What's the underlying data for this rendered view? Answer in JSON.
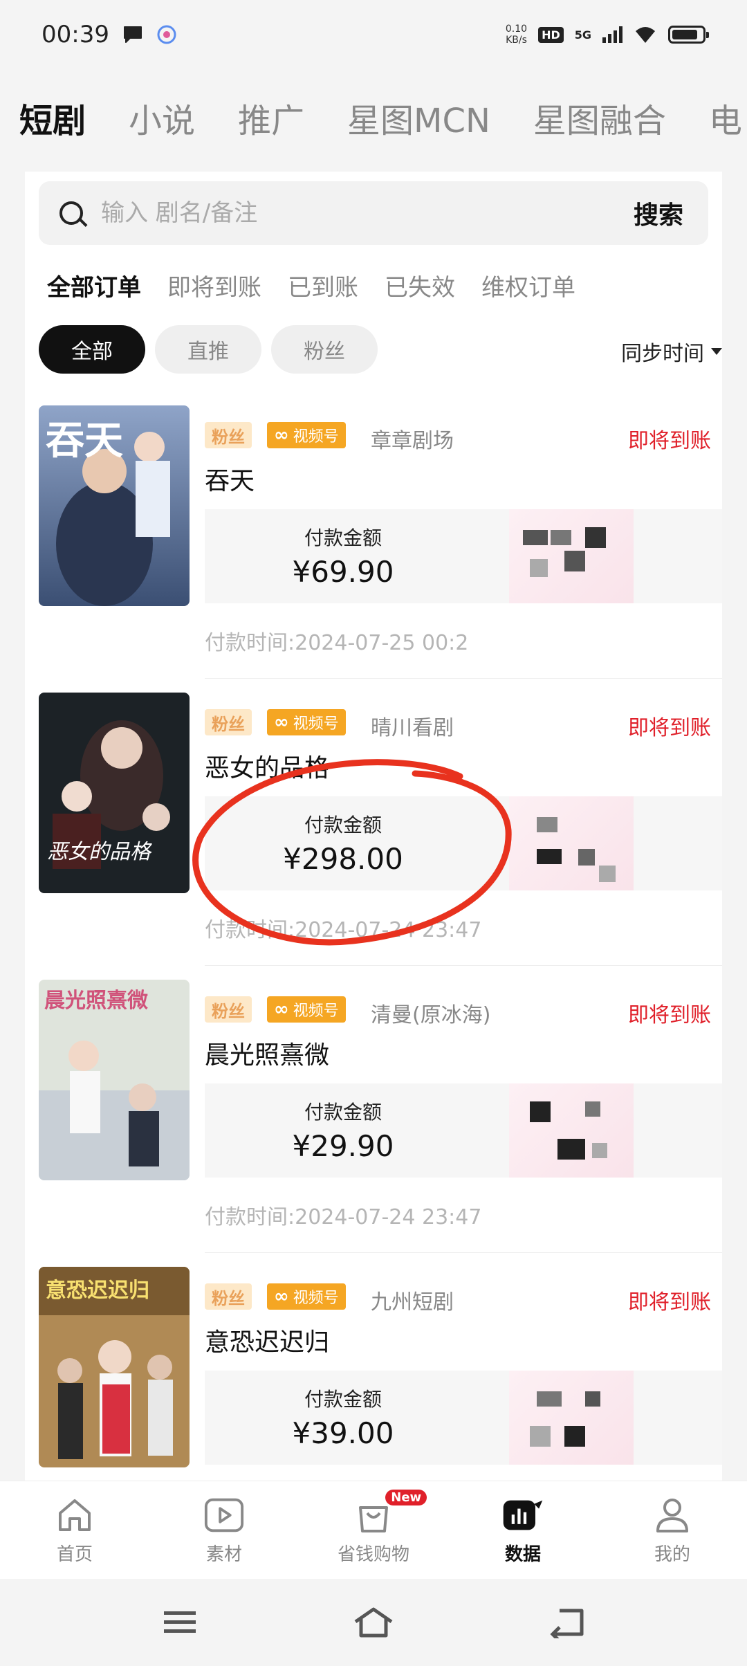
{
  "status_bar": {
    "time": "00:39",
    "net_speed_value": "0.10",
    "net_speed_unit": "KB/s",
    "hd": "HD",
    "network": "5G"
  },
  "top_tabs": [
    "短剧",
    "小说",
    "推广",
    "星图MCN",
    "星图融合",
    "电"
  ],
  "search": {
    "placeholder": "输入 剧名/备注",
    "button": "搜索"
  },
  "status_tabs": [
    "全部订单",
    "即将到账",
    "已到账",
    "已失效",
    "维权订单"
  ],
  "filters": [
    "全部",
    "直推",
    "粉丝"
  ],
  "sync_label": "同步时间",
  "pay_label": "付款金额",
  "pay_time_prefix": "付款时间:",
  "tag_fan": "粉丝",
  "tag_video": "视频号",
  "orders": [
    {
      "title": "吞天",
      "studio": "章章剧场",
      "status": "即将到账",
      "amount": "¥69.90",
      "pay_time": "2024-07-25 00:2",
      "poster_text": "吞天"
    },
    {
      "title": "恶女的品格",
      "studio": "晴川看剧",
      "status": "即将到账",
      "amount": "¥298.00",
      "pay_time": "2024-07-24 23:47",
      "poster_text": "恶女的品格"
    },
    {
      "title": "晨光照熹微",
      "studio": "清曼(原冰海)",
      "status": "即将到账",
      "amount": "¥29.90",
      "pay_time": "2024-07-24 23:47",
      "poster_text": "晨光照熹微"
    },
    {
      "title": "意恐迟迟归",
      "studio": "九州短剧",
      "status": "即将到账",
      "amount": "¥39.00",
      "pay_time": "",
      "poster_text": "意恐迟迟归"
    }
  ],
  "bottom_nav": [
    {
      "label": "首页",
      "icon": "home-icon"
    },
    {
      "label": "素材",
      "icon": "play-icon"
    },
    {
      "label": "省钱购物",
      "icon": "shopping-bag-icon",
      "badge": "New"
    },
    {
      "label": "数据",
      "icon": "data-chart-icon"
    },
    {
      "label": "我的",
      "icon": "user-icon"
    }
  ],
  "colors": {
    "accent_red": "#e0202a",
    "tag_orange": "#f5a623",
    "tag_fan_bg": "#fde8c8"
  }
}
